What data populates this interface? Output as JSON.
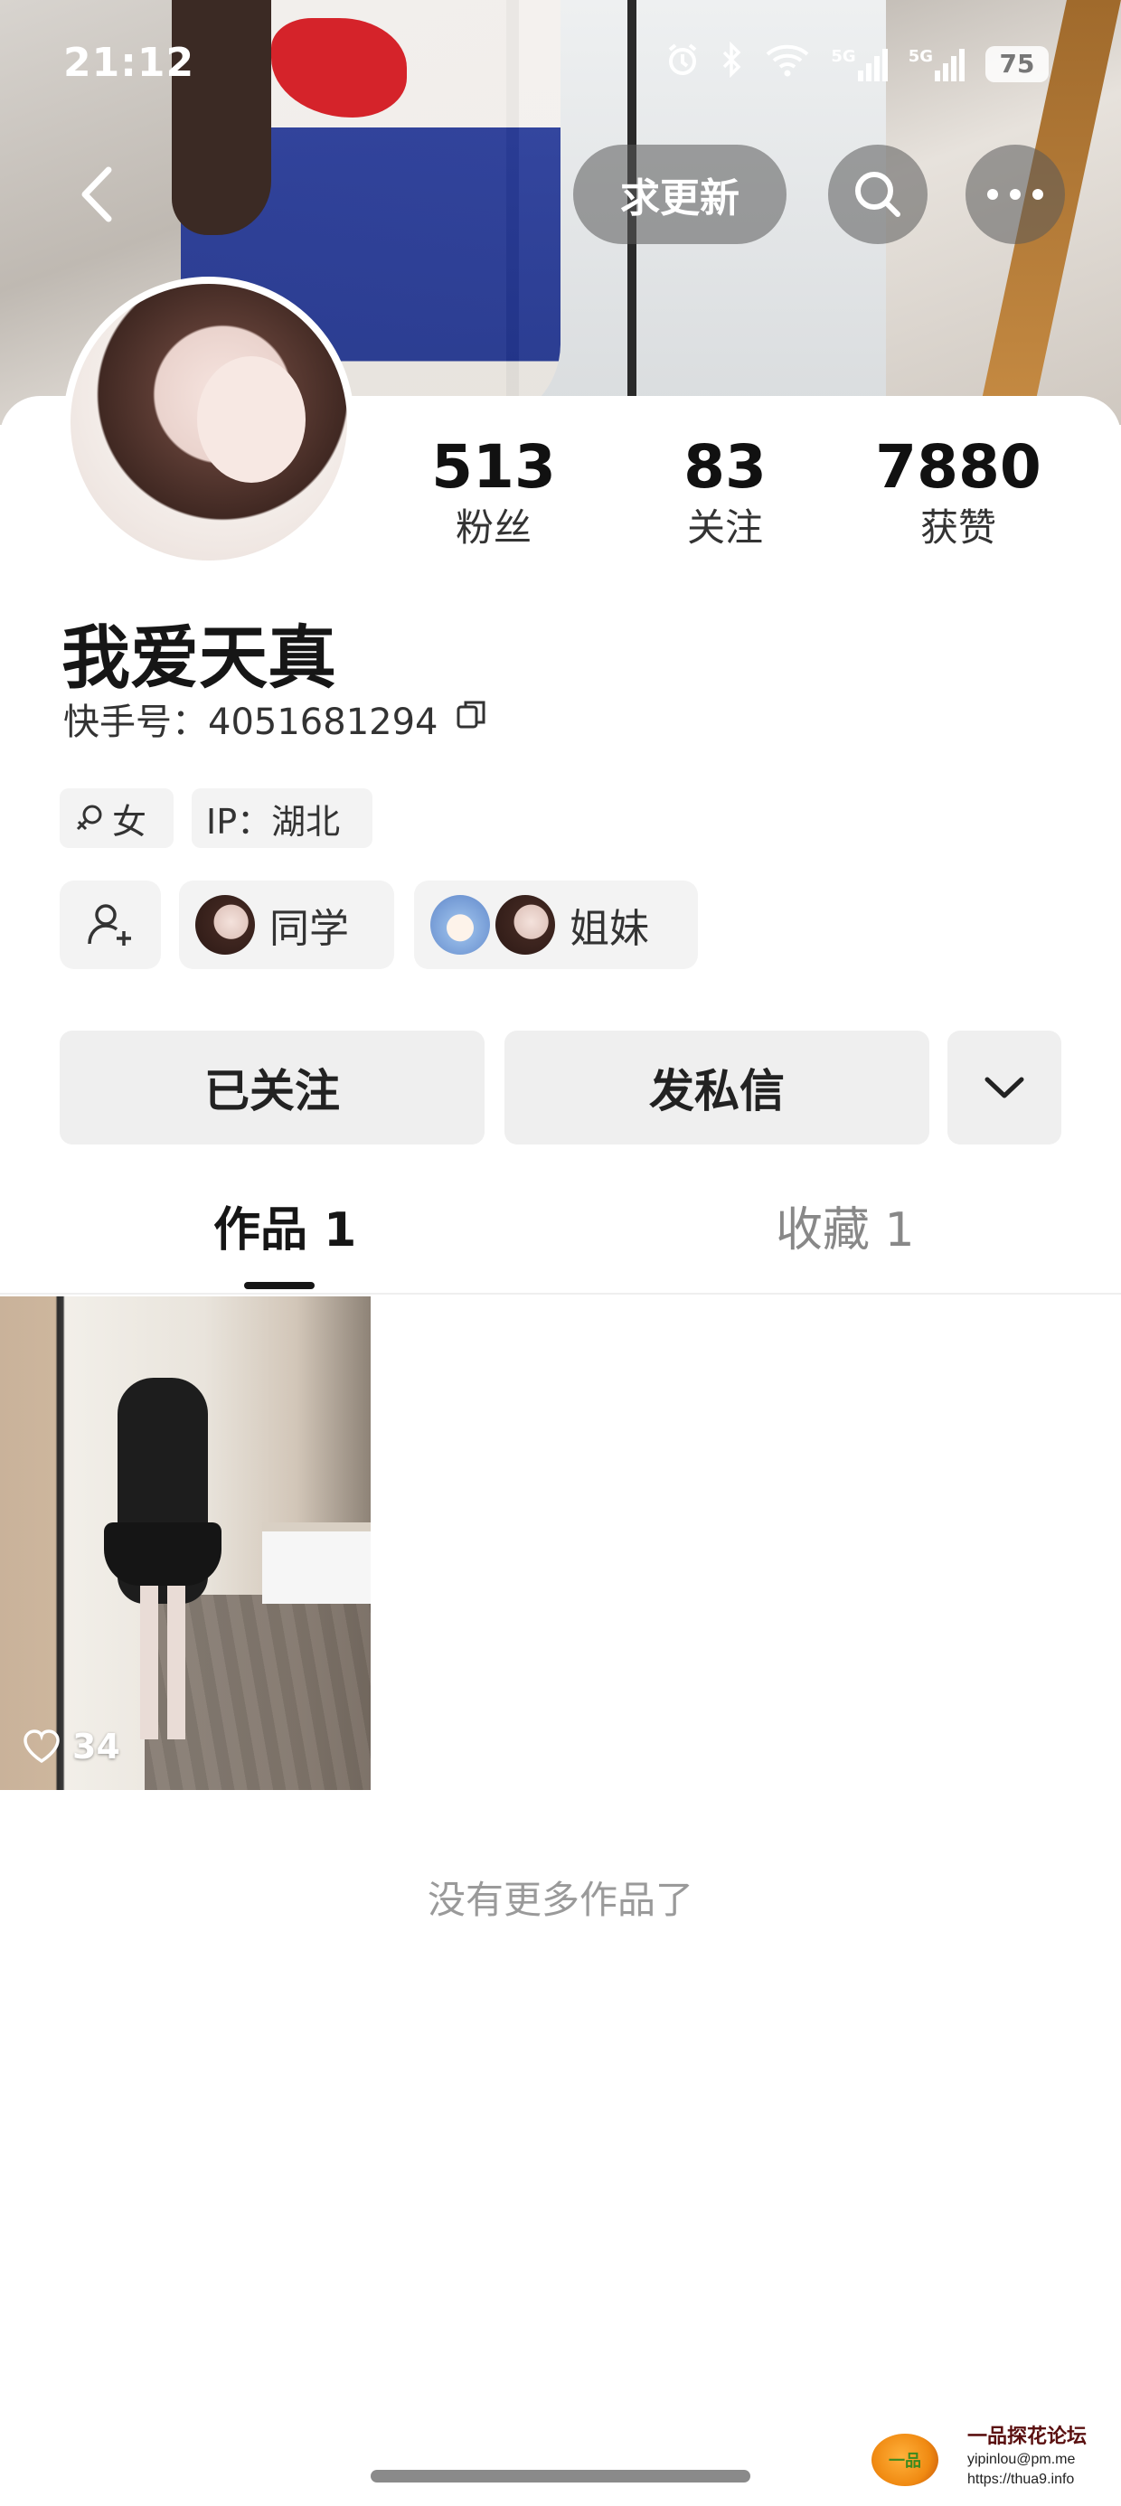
{
  "status_bar": {
    "time": "21:12",
    "signal_1": "5G",
    "signal_2": "5G",
    "battery": "75"
  },
  "top_actions": {
    "request_update_label": "求更新"
  },
  "profile": {
    "stats": [
      {
        "value": "513",
        "label": "粉丝"
      },
      {
        "value": "83",
        "label": "关注"
      },
      {
        "value": "7880",
        "label": "获赞"
      }
    ],
    "name": "我爱天真",
    "account_id_label": "快手号：4051681294",
    "tags": {
      "gender": "女",
      "ip": "IP：湖北"
    },
    "relations": [
      {
        "label": "同学"
      },
      {
        "label": "姐妹"
      }
    ]
  },
  "actions": {
    "followed_label": "已关注",
    "message_label": "发私信"
  },
  "tabs": [
    {
      "label": "作品 1",
      "active": true
    },
    {
      "label": "收藏 1",
      "active": false
    }
  ],
  "works": [
    {
      "likes": "34"
    }
  ],
  "footer": {
    "no_more": "没有更多作品了"
  },
  "watermark": {
    "logo_text": "一品",
    "title": "一品探花论坛",
    "email": "yipinlou@pm.me",
    "url": "https://thua9.info"
  },
  "colors": {
    "primary_text": "#161616",
    "muted_text": "#888888",
    "button_bg": "#efefef",
    "tag_bg": "#f3f3f3"
  }
}
